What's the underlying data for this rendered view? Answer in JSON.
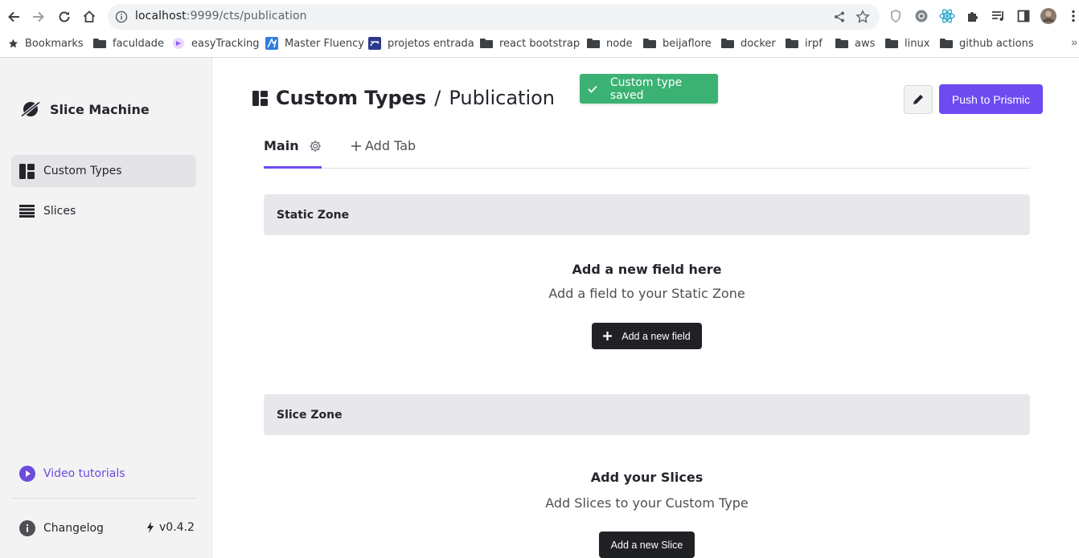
{
  "browser": {
    "url_host": "localhost",
    "url_rest": ":9999/cts/publication",
    "bookmarks": [
      {
        "label": "Bookmarks",
        "icon": "star-icon"
      },
      {
        "label": "faculdade",
        "icon": "folder-icon"
      },
      {
        "label": "easyTracking",
        "icon": "site-icon"
      },
      {
        "label": "Master Fluency",
        "icon": "site-icon"
      },
      {
        "label": "projetos entrada",
        "icon": "site-icon"
      },
      {
        "label": "react bootstrap",
        "icon": "folder-icon"
      },
      {
        "label": "node",
        "icon": "folder-icon"
      },
      {
        "label": "beijaflore",
        "icon": "folder-icon"
      },
      {
        "label": "docker",
        "icon": "folder-icon"
      },
      {
        "label": "irpf",
        "icon": "folder-icon"
      },
      {
        "label": "aws",
        "icon": "folder-icon"
      },
      {
        "label": "linux",
        "icon": "folder-icon"
      },
      {
        "label": "github actions",
        "icon": "folder-icon"
      }
    ],
    "overflow": "»"
  },
  "sidebar": {
    "brand": "Slice Machine",
    "items": [
      {
        "label": "Custom Types",
        "icon": "custom-types-icon",
        "active": true
      },
      {
        "label": "Slices",
        "icon": "slices-icon",
        "active": false
      }
    ],
    "video_tutorials": "Video tutorials",
    "changelog": "Changelog",
    "version": "v0.4.2"
  },
  "header": {
    "title": "Custom Types",
    "separator": "/",
    "subtitle": "Publication",
    "push_label": "Push to Prismic"
  },
  "toast": {
    "message": "Custom type saved",
    "color": "#3bb273"
  },
  "tabs": {
    "main_label": "Main",
    "add_label": "Add Tab"
  },
  "static_zone": {
    "header": "Static Zone",
    "empty_title": "Add a new field here",
    "empty_sub": "Add a field to your Static Zone",
    "button": "Add a new field"
  },
  "slice_zone": {
    "header": "Slice Zone",
    "empty_title": "Add your Slices",
    "empty_sub": "Add Slices to your Custom Type",
    "button": "Add a new Slice"
  },
  "colors": {
    "accent": "#6d4bf1",
    "dark_button": "#202124"
  }
}
